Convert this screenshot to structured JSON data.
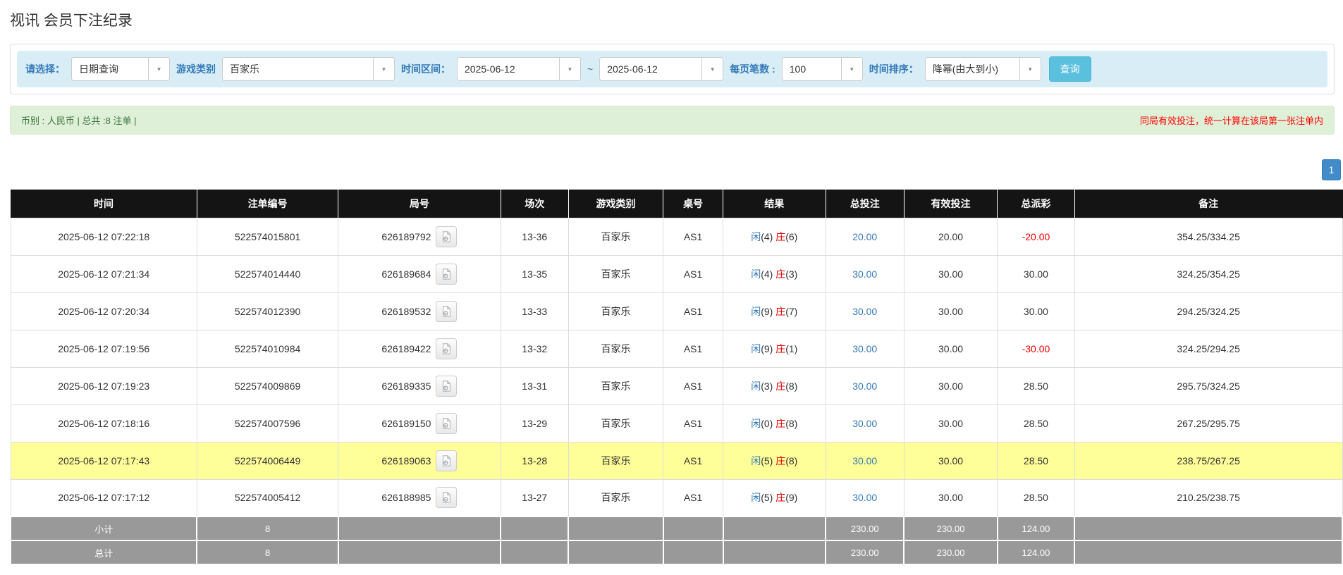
{
  "colors": {
    "header_bg": "#141414",
    "filter_bar_bg": "#d9edf7",
    "label_blue": "#337ab7",
    "btn_info": "#5bc0de",
    "success_bg": "#dff0d8",
    "success_text": "#3c763d",
    "alert_red": "#ff0000",
    "page_btn_blue": "#428bca",
    "link_blue": "#337ab7",
    "player_blue": "#337ab7",
    "banker_red": "#e60000",
    "neg_red": "#ff0000",
    "highlight_yellow": "#ffff99",
    "summary_row_bg": "#999999"
  },
  "page": {
    "title": "视讯 会员下注纪录"
  },
  "filters": {
    "select_label": "请选择：",
    "select_value": "日期查询",
    "game_type_label": "游戏类别",
    "game_type_value": "百家乐",
    "time_range_label": "时间区间：",
    "date_from": "2025-06-12",
    "tilde": "~",
    "date_to": "2025-06-12",
    "page_size_label": "每页笔数 :",
    "page_size_value": "100",
    "sort_label": "时间排序：",
    "sort_value": "降幂(由大到小)",
    "query_button": "查询"
  },
  "summary": {
    "currency_info": "币别 : 人民币 | 总共 :8 注单 |",
    "notice": "同局有效投注，统一计算在该局第一张注单内"
  },
  "pagination": {
    "page": "1"
  },
  "table": {
    "headers": [
      "时间",
      "注单编号",
      "局号",
      "场次",
      "游戏类别",
      "桌号",
      "结果",
      "总投注",
      "有效投注",
      "总派彩",
      "备注"
    ],
    "rows": [
      {
        "time": "2025-06-12 07:22:18",
        "bet_id": "522574015801",
        "round_id": "626189792",
        "session": "13-36",
        "game_type": "百家乐",
        "table_no": "AS1",
        "result": {
          "player": "闲",
          "player_points": "(4)",
          "banker": "庄",
          "banker_points": "(6)"
        },
        "total_bet": "20.00",
        "valid_bet": "20.00",
        "payout": "-20.00",
        "remark": "354.25/334.25",
        "highlight": false
      },
      {
        "time": "2025-06-12 07:21:34",
        "bet_id": "522574014440",
        "round_id": "626189684",
        "session": "13-35",
        "game_type": "百家乐",
        "table_no": "AS1",
        "result": {
          "player": "闲",
          "player_points": "(4)",
          "banker": "庄",
          "banker_points": "(3)"
        },
        "total_bet": "30.00",
        "valid_bet": "30.00",
        "payout": "30.00",
        "remark": "324.25/354.25",
        "highlight": false
      },
      {
        "time": "2025-06-12 07:20:34",
        "bet_id": "522574012390",
        "round_id": "626189532",
        "session": "13-33",
        "game_type": "百家乐",
        "table_no": "AS1",
        "result": {
          "player": "闲",
          "player_points": "(9)",
          "banker": "庄",
          "banker_points": "(7)"
        },
        "total_bet": "30.00",
        "valid_bet": "30.00",
        "payout": "30.00",
        "remark": "294.25/324.25",
        "highlight": false
      },
      {
        "time": "2025-06-12 07:19:56",
        "bet_id": "522574010984",
        "round_id": "626189422",
        "session": "13-32",
        "game_type": "百家乐",
        "table_no": "AS1",
        "result": {
          "player": "闲",
          "player_points": "(9)",
          "banker": "庄",
          "banker_points": "(1)"
        },
        "total_bet": "30.00",
        "valid_bet": "30.00",
        "payout": "-30.00",
        "remark": "324.25/294.25",
        "highlight": false
      },
      {
        "time": "2025-06-12 07:19:23",
        "bet_id": "522574009869",
        "round_id": "626189335",
        "session": "13-31",
        "game_type": "百家乐",
        "table_no": "AS1",
        "result": {
          "player": "闲",
          "player_points": "(3)",
          "banker": "庄",
          "banker_points": "(8)"
        },
        "total_bet": "30.00",
        "valid_bet": "30.00",
        "payout": "28.50",
        "remark": "295.75/324.25",
        "highlight": false
      },
      {
        "time": "2025-06-12 07:18:16",
        "bet_id": "522574007596",
        "round_id": "626189150",
        "session": "13-29",
        "game_type": "百家乐",
        "table_no": "AS1",
        "result": {
          "player": "闲",
          "player_points": "(0)",
          "banker": "庄",
          "banker_points": "(8)"
        },
        "total_bet": "30.00",
        "valid_bet": "30.00",
        "payout": "28.50",
        "remark": "267.25/295.75",
        "highlight": false
      },
      {
        "time": "2025-06-12 07:17:43",
        "bet_id": "522574006449",
        "round_id": "626189063",
        "session": "13-28",
        "game_type": "百家乐",
        "table_no": "AS1",
        "result": {
          "player": "闲",
          "player_points": "(5)",
          "banker": "庄",
          "banker_points": "(8)"
        },
        "total_bet": "30.00",
        "valid_bet": "30.00",
        "payout": "28.50",
        "remark": "238.75/267.25",
        "highlight": true
      },
      {
        "time": "2025-06-12 07:17:12",
        "bet_id": "522574005412",
        "round_id": "626188985",
        "session": "13-27",
        "game_type": "百家乐",
        "table_no": "AS1",
        "result": {
          "player": "闲",
          "player_points": "(5)",
          "banker": "庄",
          "banker_points": "(9)"
        },
        "total_bet": "30.00",
        "valid_bet": "30.00",
        "payout": "28.50",
        "remark": "210.25/238.75",
        "highlight": false
      }
    ],
    "subtotal": {
      "label": "小计",
      "count": "8",
      "total_bet": "230.00",
      "valid_bet": "230.00",
      "payout": "124.00"
    },
    "grand_total": {
      "label": "总计",
      "count": "8",
      "total_bet": "230.00",
      "valid_bet": "230.00",
      "payout": "124.00"
    }
  }
}
